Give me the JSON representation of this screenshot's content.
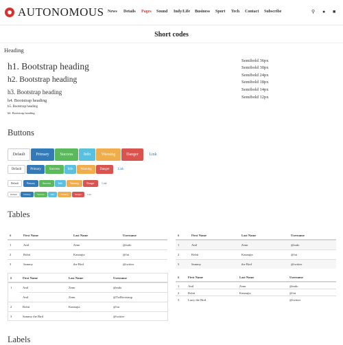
{
  "brand": {
    "name": "AUTONOMOUS",
    "accent": "#d9302c"
  },
  "nav": {
    "items": [
      "News",
      "Details",
      "Pages",
      "Sound",
      "Indy/Life",
      "Business",
      "Sport",
      "Tech",
      "Contact",
      "Subscribe"
    ],
    "active": "Pages"
  },
  "header_icons": [
    "search-icon",
    "user-icon",
    "cart-icon"
  ],
  "page": {
    "title": "Short codes"
  },
  "headings": {
    "label": "Heading",
    "items": [
      "h1. Bootstrap heading",
      "h2. Bootstrap heading",
      "h3. Bootstrap heading",
      "h4. Bootstrap heading",
      "h5. Bootstrap heading",
      "h6. Bootstrap heading"
    ],
    "sizes": [
      "Semibold 36px",
      "Semibold 30px",
      "Semibold 24px",
      "Semibold 18px",
      "Semibold 14px",
      "Semibold 12px"
    ]
  },
  "buttons": {
    "title": "Buttons",
    "labels": [
      "Default",
      "Primary",
      "Success",
      "Info",
      "Warning",
      "Danger",
      "Link"
    ]
  },
  "tables": {
    "title": "Tables",
    "headers": [
      "#",
      "First Name",
      "Last Name",
      "Username"
    ],
    "rows": [
      [
        "1",
        "Anil",
        "Zenn",
        "@mdo"
      ],
      [
        "2",
        "Rohit",
        "Kanaujia",
        "@fat"
      ],
      [
        "3",
        "Sammy",
        "the Bird",
        "@twitter"
      ]
    ],
    "rows_rowspan": [
      [
        "1",
        "Anil",
        "Zenn",
        "@mdo"
      ],
      [
        "",
        "Anil",
        "Zenn",
        "@TwBootstrap"
      ],
      [
        "2",
        "Rohit",
        "Kanaujia",
        "@fat"
      ],
      [
        "3",
        "Sammy the Bird",
        "",
        "@twitter"
      ]
    ],
    "rows_colspan": [
      [
        "1",
        "Anil",
        "Zenn",
        "@mdo"
      ],
      [
        "2",
        "Rohit",
        "Kanaujia",
        "@fat"
      ],
      [
        "3",
        "Larry the Bird",
        "",
        "@twitter"
      ]
    ]
  },
  "labels": {
    "title": "Labels"
  }
}
